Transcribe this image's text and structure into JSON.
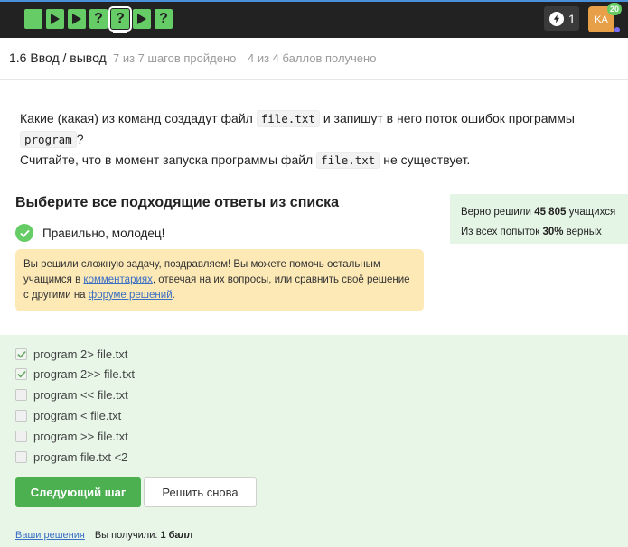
{
  "topbar": {
    "steps": [
      {
        "kind": "text",
        "icon": "text-step-icon",
        "glyph": ""
      },
      {
        "kind": "video",
        "icon": "play-icon",
        "glyph": ""
      },
      {
        "kind": "video",
        "icon": "play-icon",
        "glyph": ""
      },
      {
        "kind": "quiz",
        "icon": "question-icon",
        "glyph": "?"
      },
      {
        "kind": "quiz",
        "icon": "question-icon",
        "glyph": "?",
        "current": true
      },
      {
        "kind": "video",
        "icon": "play-icon",
        "glyph": ""
      },
      {
        "kind": "quiz",
        "icon": "question-icon",
        "glyph": "?"
      }
    ],
    "energy_count": "1",
    "avatar_initials": "KA",
    "avatar_badge": "20",
    "colors": {
      "bar": "#222222",
      "step": "#66cc66",
      "avatar": "#e8a048"
    }
  },
  "lesson": {
    "title": "1.6 Ввод / вывод",
    "steps_progress": "7 из 7 шагов пройдено",
    "score_progress": "4 из 4 баллов  получено"
  },
  "question": {
    "part1": "Какие (какая) из команд создадут файл",
    "code1": "file.txt",
    "part2": "и запишут в него поток ошибок программы",
    "code2": "program",
    "part3": "?",
    "part4": "Считайте, что в момент запуска программы файл",
    "code3": "file.txt",
    "part5": "не существует."
  },
  "choose_title": "Выберите все подходящие ответы из списка",
  "stats": {
    "solved_prefix": "Верно решили",
    "solved_count": "45 805",
    "solved_suffix": "учащихся",
    "attempts_prefix": "Из всех попыток",
    "attempts_percent": "30%",
    "attempts_suffix": "верных"
  },
  "result": {
    "correct_text": "Правильно, молодец!",
    "congrats_part1": "Вы решили сложную задачу, поздравляем! Вы можете помочь остальным учащимся в",
    "comments_link": "комментариях",
    "congrats_part2": ", отвечая на их вопросы, или сравнить своё решение с другими на",
    "forum_link": "форуме решений",
    "congrats_part3": "."
  },
  "options": [
    {
      "label": "program 2> file.txt",
      "checked": true
    },
    {
      "label": "program 2>> file.txt",
      "checked": true
    },
    {
      "label": "program << file.txt",
      "checked": false
    },
    {
      "label": "program < file.txt",
      "checked": false
    },
    {
      "label": "program >> file.txt",
      "checked": false
    },
    {
      "label": "program file.txt <2",
      "checked": false
    }
  ],
  "buttons": {
    "next": "Следующий шаг",
    "retry": "Решить снова"
  },
  "footer": {
    "your_solutions": "Ваши решения",
    "received_prefix": "Вы получили:",
    "received_value": "1 балл"
  }
}
